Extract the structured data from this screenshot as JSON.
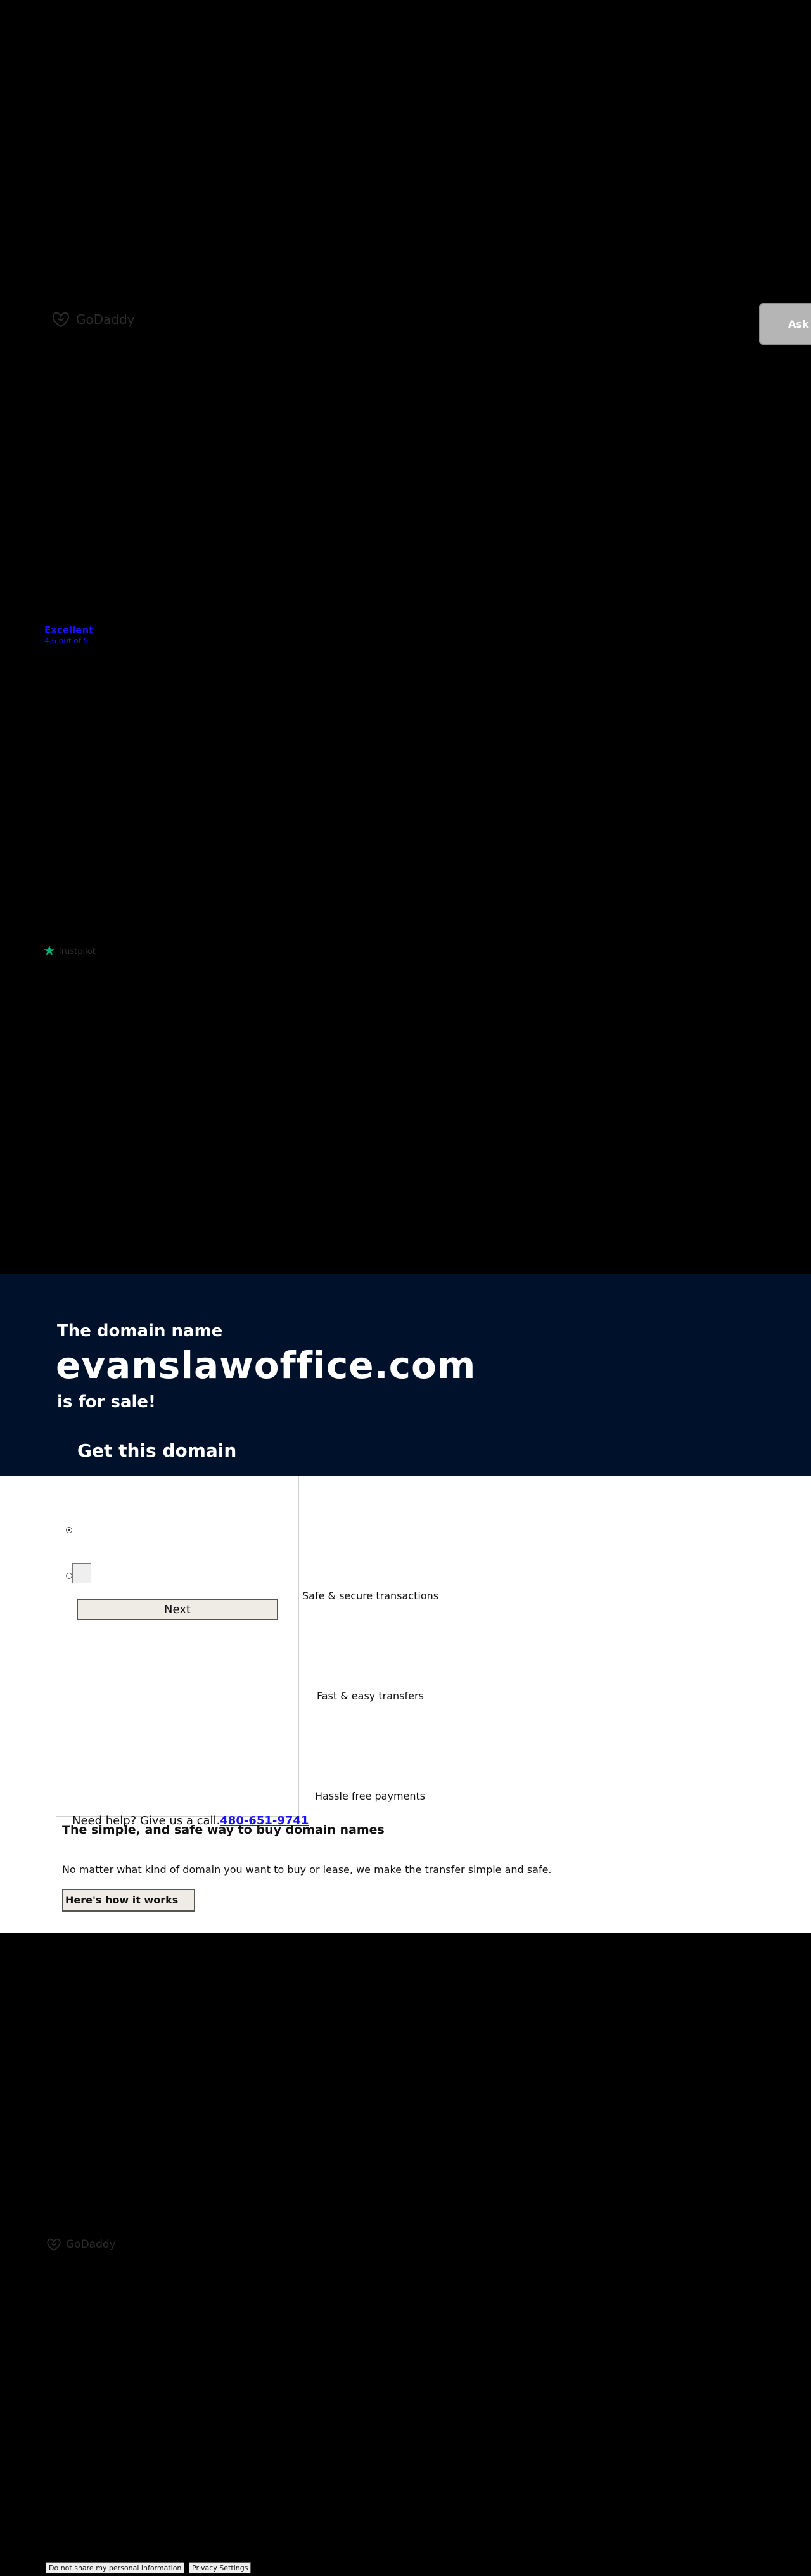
{
  "header": {
    "logo_text": "GoDaddy",
    "ask_button_label": "Ask AI"
  },
  "rating": {
    "label": "Excellent",
    "sub": "4.6 out of 5"
  },
  "trustpilot": {
    "label": "Trustpilot"
  },
  "hero": {
    "line1": "The domain name",
    "domain": "evanslawoffice.com",
    "line3": "is for sale!",
    "cta": "Get this domain"
  },
  "form": {
    "next_label": "Next"
  },
  "benefits": [
    "Safe & secure transactions",
    "Fast & easy transfers",
    "Hassle free payments"
  ],
  "help": {
    "prefix": "Need help? Give us a call.",
    "phone": "480-651-9741"
  },
  "simple": {
    "title": "The simple, and safe way to buy domain names",
    "description": "No matter what kind of domain you want to buy or lease, we make the transfer simple and safe.",
    "button_label": "Here's how it works"
  },
  "footer": {
    "logo_text": "GoDaddy",
    "do_not_share_label": "Do not share my personal information",
    "privacy_label": "Privacy Settings"
  },
  "colors": {
    "page_background": "#000000",
    "hero_background": "#00112b",
    "link_blue": "#1a12ff",
    "trustpilot_green": "#00b67a"
  }
}
